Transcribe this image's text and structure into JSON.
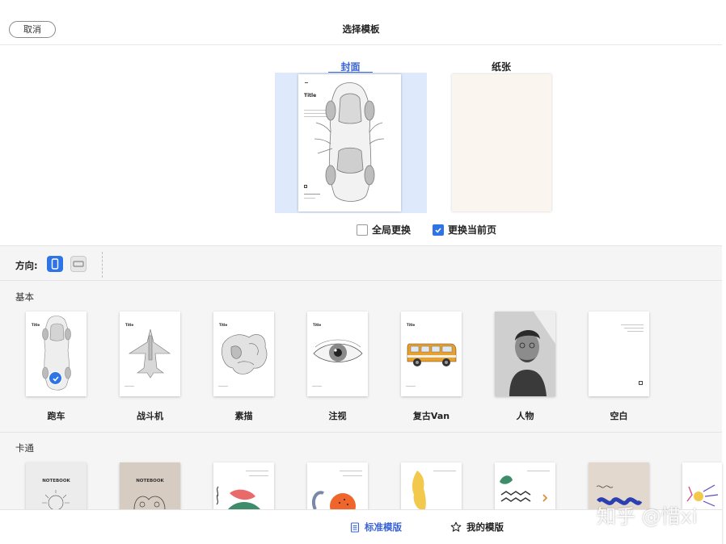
{
  "header": {
    "cancel_label": "取消",
    "title": "选择模板"
  },
  "preview_tabs": {
    "cover": "封面",
    "paper": "纸张"
  },
  "options": {
    "replace_all_label": "全局更换",
    "replace_all_checked": false,
    "replace_current_label": "更换当前页",
    "replace_current_checked": true
  },
  "orientation": {
    "label": "方向:",
    "selected": "portrait"
  },
  "sections": {
    "basic": {
      "label": "基本",
      "templates": [
        {
          "name": "跑车",
          "selected": true
        },
        {
          "name": "战斗机",
          "selected": false
        },
        {
          "name": "素描",
          "selected": false
        },
        {
          "name": "注视",
          "selected": false
        },
        {
          "name": "复古Van",
          "selected": false
        },
        {
          "name": "人物",
          "selected": false
        },
        {
          "name": "空白",
          "selected": false
        }
      ]
    },
    "cartoon": {
      "label": "卡通",
      "thumb_text": {
        "notebook_1": "NOTEBOOK",
        "notebook_2": "NOTEBOOK"
      }
    }
  },
  "thumb_text": {
    "title": "Title"
  },
  "bottom_tabs": {
    "standard": "标准模版",
    "mine": "我的模版"
  },
  "watermark": "知乎 @惜xi",
  "colors": {
    "accent": "#2f74e6",
    "tab_active": "#3a64d6",
    "selection_bg": "#deeafb",
    "paper": "#faf6ef"
  }
}
